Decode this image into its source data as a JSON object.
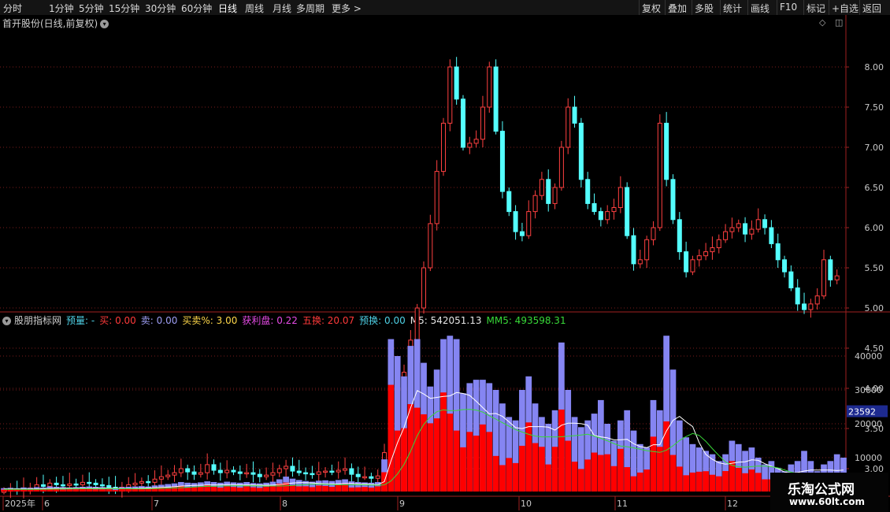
{
  "toolbar": {
    "periods": [
      "分时",
      "1分钟",
      "5分钟",
      "15分钟",
      "30分钟",
      "60分钟",
      "日线",
      "周线",
      "月线",
      "多周期",
      "更多 >"
    ],
    "active_period": "日线",
    "right_buttons": [
      "复权",
      "叠加",
      "多股",
      "统计",
      "画线",
      "F10",
      "标记",
      "+自选",
      "返回"
    ]
  },
  "price_panel": {
    "title": "首开股份(日线,前复权)",
    "axis_ticks": [
      "8.00",
      "7.50",
      "7.00",
      "6.50",
      "6.00",
      "5.50",
      "5.00",
      "4.50",
      "4.00",
      "3.50",
      "3.00"
    ]
  },
  "indicator": {
    "name": "股朋指标网",
    "items": [
      {
        "label": "预量: -",
        "color": "#4fd1e6"
      },
      {
        "label": "买: 0.00",
        "color": "#ff3a3a"
      },
      {
        "label": "卖: 0.00",
        "color": "#9f9ff5"
      },
      {
        "label": "买卖%: 3.00",
        "color": "#ffd84a"
      },
      {
        "label": "获利盘: 0.22",
        "color": "#e64be6"
      },
      {
        "label": "五换: 20.07",
        "color": "#ff3a3a"
      },
      {
        "label": "预换: 0.00",
        "color": "#4fd1e6"
      },
      {
        "label": "M5: 542051.13",
        "color": "#e6e6e6"
      },
      {
        "label": "MM5: 493598.31",
        "color": "#38d938"
      }
    ],
    "axis_ticks": [
      "40000",
      "30000",
      "20000",
      "10000"
    ],
    "current_value": "23592"
  },
  "date_axis": [
    "2025年",
    "6",
    "7",
    "8",
    "9",
    "10",
    "11",
    "12"
  ],
  "watermark": {
    "line1": "乐淘公式网",
    "line2": "www.60lt.com"
  },
  "colors": {
    "up": "#ff4040",
    "down": "#54ffff",
    "grid": "#7a1d1d",
    "buy": "#ff0000",
    "sell": "#8585f2"
  },
  "chart_data": {
    "type": "candlestick",
    "y_range": [
      2.5,
      8.5
    ],
    "closes": [
      2.72,
      2.74,
      2.73,
      2.75,
      2.76,
      2.8,
      2.78,
      2.82,
      2.8,
      2.79,
      2.81,
      2.8,
      2.83,
      2.82,
      2.8,
      2.79,
      2.77,
      2.74,
      2.77,
      2.8,
      2.82,
      2.84,
      2.83,
      2.87,
      2.9,
      2.92,
      2.95,
      3.0,
      2.96,
      2.93,
      2.95,
      3.05,
      2.98,
      2.95,
      2.98,
      2.96,
      2.94,
      2.95,
      2.93,
      2.9,
      2.92,
      2.95,
      3.0,
      3.03,
      2.97,
      2.95,
      2.94,
      2.93,
      2.96,
      2.97,
      2.96,
      2.98,
      3.0,
      2.93,
      2.9,
      2.9,
      2.88,
      2.91,
      3.2,
      3.52,
      4.0,
      4.2,
      4.6,
      5.0,
      5.5,
      6.05,
      6.7,
      7.3,
      8.0,
      7.6,
      7.0,
      7.05,
      7.1,
      7.5,
      8.0,
      7.2,
      6.45,
      6.2,
      5.95,
      5.9,
      6.2,
      6.4,
      6.6,
      6.3,
      6.5,
      7.0,
      7.5,
      7.3,
      6.6,
      6.3,
      6.2,
      6.1,
      6.2,
      6.25,
      6.5,
      5.9,
      5.55,
      5.6,
      5.85,
      6.0,
      7.3,
      6.6,
      6.1,
      5.7,
      5.45,
      5.6,
      5.65,
      5.7,
      5.75,
      5.85,
      5.95,
      6.0,
      6.05,
      5.92,
      5.98,
      6.1,
      6.0,
      5.8,
      5.6,
      5.45,
      5.25,
      5.05,
      4.98,
      5.05,
      5.15,
      5.6,
      5.35,
      5.4
    ],
    "indicator_range": [
      0,
      50000
    ],
    "volume_total": [
      1000,
      1100,
      1000,
      1200,
      1100,
      1300,
      1200,
      1500,
      1400,
      1300,
      1200,
      1300,
      1400,
      1500,
      1400,
      1300,
      1200,
      1100,
      1300,
      1400,
      1500,
      1600,
      1500,
      1800,
      2000,
      2200,
      2400,
      2800,
      2600,
      2500,
      2700,
      3000,
      2800,
      2600,
      2900,
      2700,
      2600,
      2800,
      2500,
      2400,
      2600,
      2900,
      3600,
      4400,
      3800,
      3400,
      3100,
      2900,
      3200,
      3300,
      3100,
      3400,
      3600,
      3000,
      2800,
      2700,
      2600,
      2800,
      9500,
      45000,
      40000,
      34000,
      43000,
      45000,
      38000,
      31000,
      36000,
      45000,
      46000,
      45000,
      29000,
      32000,
      33000,
      33000,
      32000,
      30000,
      26000,
      22000,
      21000,
      30000,
      34000,
      26000,
      22000,
      20000,
      24000,
      44000,
      30000,
      22000,
      19000,
      21000,
      23000,
      27000,
      20000,
      15000,
      21000,
      24000,
      18000,
      14000,
      13000,
      27000,
      24000,
      46000,
      36000,
      21000,
      16000,
      14000,
      13000,
      12000,
      11000,
      9000,
      11000,
      15000,
      14000,
      12000,
      13000,
      10000,
      8000,
      9000,
      7000,
      6000,
      8000,
      9000,
      12000,
      9000,
      6000,
      8000,
      9000,
      11000,
      10000
    ],
    "buy_ratio": [
      0.55,
      0.5,
      0.6,
      0.45,
      0.5,
      0.55,
      0.5,
      0.6,
      0.5,
      0.45,
      0.55,
      0.5,
      0.6,
      0.5,
      0.45,
      0.5,
      0.55,
      0.4,
      0.6,
      0.55,
      0.6,
      0.5,
      0.55,
      0.6,
      0.65,
      0.5,
      0.55,
      0.6,
      0.45,
      0.5,
      0.55,
      0.65,
      0.5,
      0.45,
      0.55,
      0.5,
      0.45,
      0.55,
      0.5,
      0.45,
      0.55,
      0.6,
      0.65,
      0.6,
      0.5,
      0.45,
      0.5,
      0.45,
      0.55,
      0.5,
      0.45,
      0.55,
      0.6,
      0.4,
      0.45,
      0.5,
      0.45,
      0.55,
      0.6,
      0.7,
      0.45,
      0.55,
      0.6,
      0.55,
      0.6,
      0.65,
      0.6,
      0.65,
      0.5,
      0.4,
      0.45,
      0.55,
      0.5,
      0.6,
      0.55,
      0.35,
      0.3,
      0.45,
      0.4,
      0.45,
      0.6,
      0.55,
      0.6,
      0.4,
      0.55,
      0.55,
      0.5,
      0.4,
      0.35,
      0.45,
      0.5,
      0.4,
      0.55,
      0.5,
      0.6,
      0.3,
      0.25,
      0.4,
      0.5,
      0.6,
      0.55,
      0.45,
      0.3,
      0.35,
      0.3,
      0.4,
      0.45,
      0.5,
      0.45,
      0.5,
      0.55,
      0.6,
      0.5,
      0.45,
      0.5,
      0.55,
      0.45,
      0.4,
      0.35,
      0.3,
      0.35,
      0.4,
      0.45,
      0.55,
      0.5,
      0.6,
      0.55,
      0.5
    ],
    "m5_line_range": [
      0,
      50000
    ],
    "mm5_line_range": [
      0,
      50000
    ]
  }
}
